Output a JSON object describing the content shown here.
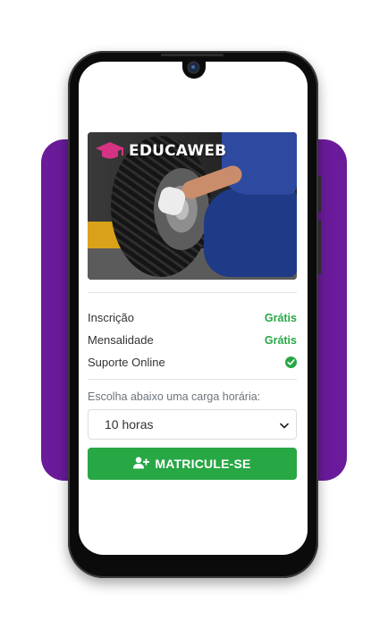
{
  "brand": {
    "name": "EDUCAWEB",
    "icon": "graduation-cap-icon",
    "icon_color": "#d63384"
  },
  "pricing": [
    {
      "label": "Inscrição",
      "value": "Grátis"
    },
    {
      "label": "Mensalidade",
      "value": "Grátis"
    },
    {
      "label": "Suporte Online",
      "icon": "check-circle-icon"
    }
  ],
  "course_hours": {
    "label": "Escolha abaixo uma carga horária:",
    "selected": "10 horas"
  },
  "enroll_button": {
    "label": "MATRICULE-SE",
    "icon": "user-plus-icon"
  },
  "colors": {
    "accent_green": "#28a745",
    "background_purple": "#6a1b9a"
  }
}
